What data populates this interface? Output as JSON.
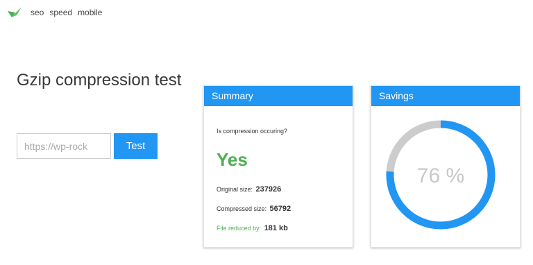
{
  "nav": {
    "items": [
      "seo",
      "speed",
      "mobile"
    ],
    "logo_color": "#4caf50"
  },
  "page": {
    "title": "Gzip compression test"
  },
  "form": {
    "url_value": "https://wp-rock",
    "button_label": "Test"
  },
  "summary": {
    "header": "Summary",
    "question": "Is compression occuring?",
    "answer": "Yes",
    "original_label": "Original size:",
    "original_value": "237926",
    "compressed_label": "Compressed size:",
    "compressed_value": "56792",
    "reduced_label": "File reduced by:",
    "reduced_value": "181 kb"
  },
  "savings": {
    "header": "Savings",
    "percent": 76,
    "percent_label": "76 %",
    "filled_color": "#2196f3",
    "track_color": "#cccccc"
  },
  "colors": {
    "accent": "#2196f3",
    "success": "#4caf50"
  }
}
